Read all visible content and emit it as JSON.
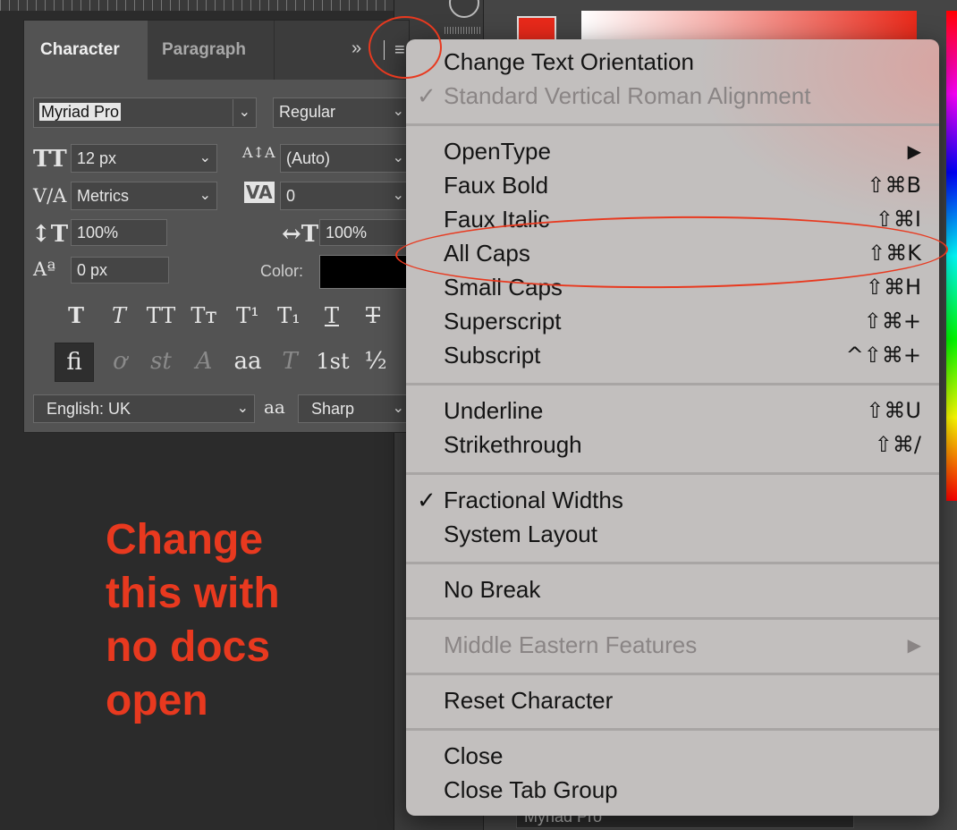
{
  "panel": {
    "tabs": [
      "Character",
      "Paragraph"
    ],
    "font_family": "Myriad Pro",
    "font_style": "Regular",
    "font_size": "12 px",
    "leading": "(Auto)",
    "kerning": "Metrics",
    "tracking": "0",
    "vertical_scale": "100%",
    "horizontal_scale": "100%",
    "baseline_shift": "0 px",
    "color_label": "Color:",
    "color_value": "#000000",
    "language": "English: UK",
    "antialias": "Sharp",
    "antialias_icon": "aa",
    "icons": {
      "size": "TT",
      "leading": "A↕A",
      "kerning": "V/A",
      "tracking": "VA",
      "vscale": "↕T",
      "hscale": "↔T",
      "baseline": "Aª"
    },
    "style_buttons": [
      "T",
      "T",
      "TT",
      "Tт",
      "T¹",
      "T₁",
      "T",
      "T"
    ],
    "opentype_buttons": [
      "ﬁ",
      "ơ",
      "st",
      "A",
      "aa",
      "T",
      "1st",
      "½"
    ]
  },
  "annotation": {
    "lines": [
      "Change",
      "this with",
      "no docs",
      "open"
    ],
    "color": "#e8391f"
  },
  "background": {
    "bottom_select": "Myriad Pro"
  },
  "menu": {
    "items": [
      {
        "label": "Change Text Orientation",
        "shortcut": "",
        "check": "",
        "disabled": false
      },
      {
        "label": "Standard Vertical Roman Alignment",
        "shortcut": "",
        "check": "✓",
        "disabled": true
      },
      {
        "label": "OpenType",
        "shortcut": "▶",
        "check": "",
        "disabled": false
      },
      {
        "label": "Faux Bold",
        "shortcut": "⇧⌘B",
        "check": "",
        "disabled": false
      },
      {
        "label": "Faux Italic",
        "shortcut": "⇧⌘I",
        "check": "",
        "disabled": false
      },
      {
        "label": "All Caps",
        "shortcut": "⇧⌘K",
        "check": "",
        "disabled": false
      },
      {
        "label": "Small Caps",
        "shortcut": "⇧⌘H",
        "check": "",
        "disabled": false
      },
      {
        "label": "Superscript",
        "shortcut": "⇧⌘+",
        "check": "",
        "disabled": false
      },
      {
        "label": "Subscript",
        "shortcut": "^⇧⌘+",
        "check": "",
        "disabled": false
      },
      {
        "label": "Underline",
        "shortcut": "⇧⌘U",
        "check": "",
        "disabled": false
      },
      {
        "label": "Strikethrough",
        "shortcut": "⇧⌘/",
        "check": "",
        "disabled": false
      },
      {
        "label": "Fractional Widths",
        "shortcut": "",
        "check": "✓",
        "disabled": false
      },
      {
        "label": "System Layout",
        "shortcut": "",
        "check": "",
        "disabled": false
      },
      {
        "label": "No Break",
        "shortcut": "",
        "check": "",
        "disabled": false
      },
      {
        "label": "Middle Eastern Features",
        "shortcut": "▶",
        "check": "",
        "disabled": true
      },
      {
        "label": "Reset Character",
        "shortcut": "",
        "check": "",
        "disabled": false
      },
      {
        "label": "Close",
        "shortcut": "",
        "check": "",
        "disabled": false
      },
      {
        "label": "Close Tab Group",
        "shortcut": "",
        "check": "",
        "disabled": false
      }
    ]
  }
}
